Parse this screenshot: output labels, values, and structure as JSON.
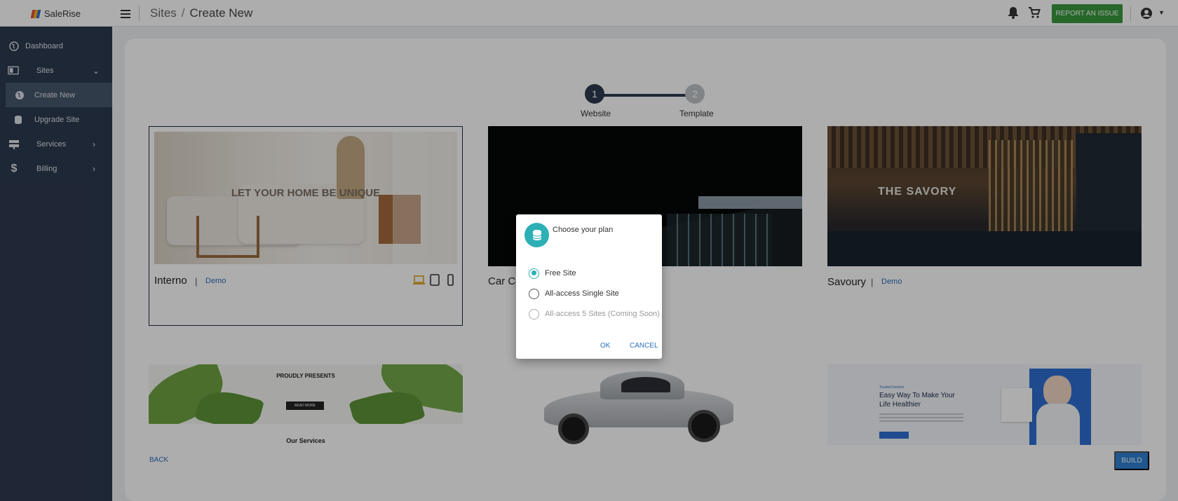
{
  "app": {
    "logo_text": "SaleRise"
  },
  "breadcrumb": {
    "parent": "Sites",
    "separator": "/",
    "current": "Create New"
  },
  "header": {
    "report_label": "REPORT AN ISSUE"
  },
  "sidebar": {
    "items": [
      {
        "label": "Dashboard",
        "icon": "globe-icon"
      },
      {
        "label": "Sites",
        "icon": "browser-icon"
      },
      {
        "label": "Create New",
        "icon": "globe-plus-icon",
        "active": true
      },
      {
        "label": "Upgrade Site",
        "icon": "database-icon"
      },
      {
        "label": "Services",
        "icon": "server-icon"
      },
      {
        "label": "Billing",
        "icon": "dollar-icon"
      }
    ]
  },
  "stepper": {
    "steps": [
      {
        "number": "1",
        "label": "Website"
      },
      {
        "number": "2",
        "label": "Template"
      }
    ]
  },
  "templates": {
    "interno": {
      "name": "Interno",
      "demo": "Demo",
      "headline": "LET YOUR HOME BE UNIQUE"
    },
    "car": {
      "name": "Car Co"
    },
    "savoury": {
      "name": "Savoury",
      "demo": "Demo",
      "headline": "THE SAVORY"
    },
    "eco": {
      "headline": "PROUDLY PRESENTS",
      "button": "READ MORE",
      "section": "Our Services"
    },
    "health": {
      "tag": "Trusted Doctors",
      "headline": "Easy Way To Make Your Life Healthier"
    }
  },
  "actions": {
    "back": "BACK",
    "build": "BUILD"
  },
  "dialog": {
    "title": "Choose your plan",
    "options": [
      {
        "label": "Free Site",
        "checked": true,
        "disabled": false
      },
      {
        "label": "All-access Single Site",
        "checked": false,
        "disabled": false
      },
      {
        "label": "All-access 5 Sites (Coming Soon)",
        "checked": false,
        "disabled": true
      }
    ],
    "ok": "OK",
    "cancel": "CANCEL"
  },
  "colors": {
    "sidebar": "#2d3a4f",
    "accent": "#2cb0b5",
    "report": "#3a9a3f",
    "build": "#2f80d1",
    "link": "#2a6ebb"
  }
}
